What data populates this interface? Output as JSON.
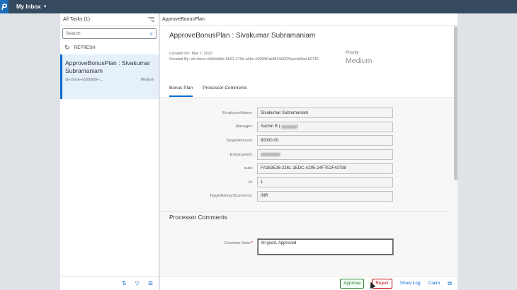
{
  "shell": {
    "title": "My Inbox",
    "logo": "P"
  },
  "master": {
    "header": "All Tasks (1)",
    "search_placeholder": "Search",
    "refresh_label": "REFRESH",
    "task": {
      "title": "ApproveBonusPlan : Sivakumar Subramaniam",
      "id": "sb-clone-e5d0dd9e-...",
      "priority": "Medium"
    }
  },
  "detail": {
    "titlebar": "ApproveBonusPlan",
    "heading": "ApproveBonusPlan : Sivakumar Subramaniam",
    "created_on": "Created On: Mar 7, 2022",
    "created_by": "Created By: sb-clone-e5d0dd9e-5b01-479d-a4bc-c699fd1dcf82!b3325|workflow!b2746",
    "priority_label": "Priority",
    "priority_value": "Medium",
    "tabs": [
      "Bonus Plan",
      "Processor Comments"
    ],
    "fields": [
      {
        "label": "EmployeeName:",
        "value": "Sivakumar Subramaniam"
      },
      {
        "label": "Manager:",
        "value": "Sachin B ("
      },
      {
        "label": "TargetAmount:",
        "value": "80000.00"
      },
      {
        "label": "EmployeeId:",
        "value": ""
      },
      {
        "label": "suid:",
        "value": "FA163E26-2261-1EDC-A295-24F7E2F43798"
      },
      {
        "label": "Id:",
        "value": "1"
      },
      {
        "label": "TargetAmountCurrency:",
        "value": "INR"
      }
    ],
    "section2_title": "Processor Comments",
    "decision_label": "Decision Note:",
    "decision_required": "*",
    "decision_value": "All good, Approved"
  },
  "footer": {
    "approve": "Approve",
    "reject": "Reject",
    "show_log": "Show Log",
    "claim": "Claim"
  }
}
